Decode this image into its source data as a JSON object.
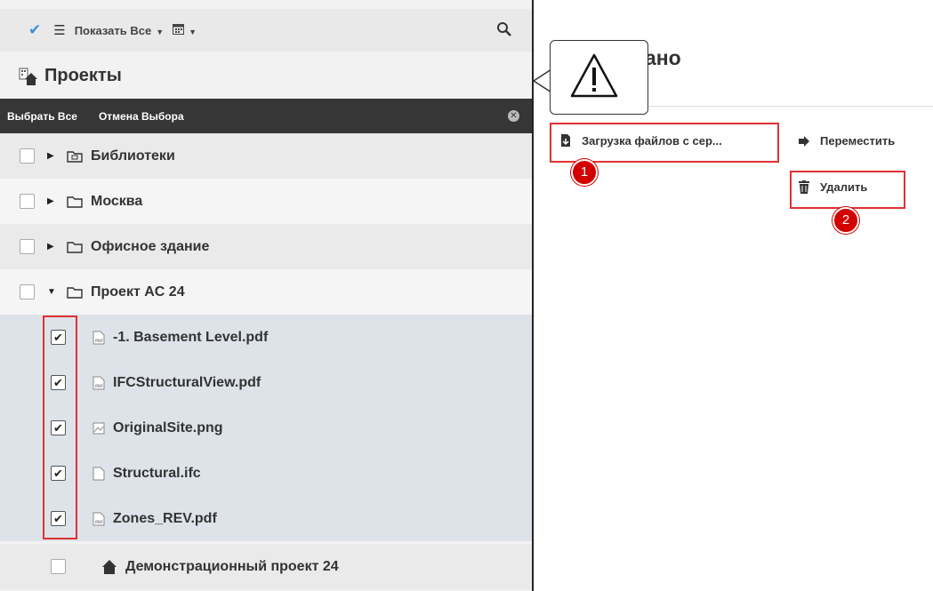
{
  "toolbar": {
    "show_all_label": "Показать Все"
  },
  "projects": {
    "title": "Проекты"
  },
  "selection_bar": {
    "select_all": "Выбрать Все",
    "cancel_selection": "Отмена Выбора"
  },
  "tree": {
    "items": [
      {
        "label": "Библиотеки",
        "type": "library-folder",
        "checked": false,
        "expanded": false
      },
      {
        "label": "Москва",
        "type": "folder",
        "checked": false,
        "expanded": false
      },
      {
        "label": "Офисное здание",
        "type": "folder",
        "checked": false,
        "expanded": false
      },
      {
        "label": "Проект AC 24",
        "type": "folder",
        "checked": false,
        "expanded": true
      },
      {
        "label": "-1. Basement Level.pdf",
        "type": "pdf",
        "checked": true
      },
      {
        "label": "IFCStructuralView.pdf",
        "type": "pdf",
        "checked": true
      },
      {
        "label": "OriginalSite.png",
        "type": "image",
        "checked": true
      },
      {
        "label": "Structural.ifc",
        "type": "file",
        "checked": true
      },
      {
        "label": "Zones_REV.pdf",
        "type": "pdf",
        "checked": true
      },
      {
        "label": "Демонстрационный проект 24",
        "type": "project",
        "checked": false
      }
    ]
  },
  "right": {
    "title_fragment": "ано",
    "actions": {
      "download": "Загрузка файлов с сер...",
      "move": "Переместить",
      "delete": "Удалить"
    },
    "badges": [
      "1",
      "2"
    ]
  },
  "colors": {
    "highlight_red": "#e03131",
    "badge_red": "#d40000",
    "check_blue": "#3b8fd6",
    "selection_bar": "#363636"
  }
}
